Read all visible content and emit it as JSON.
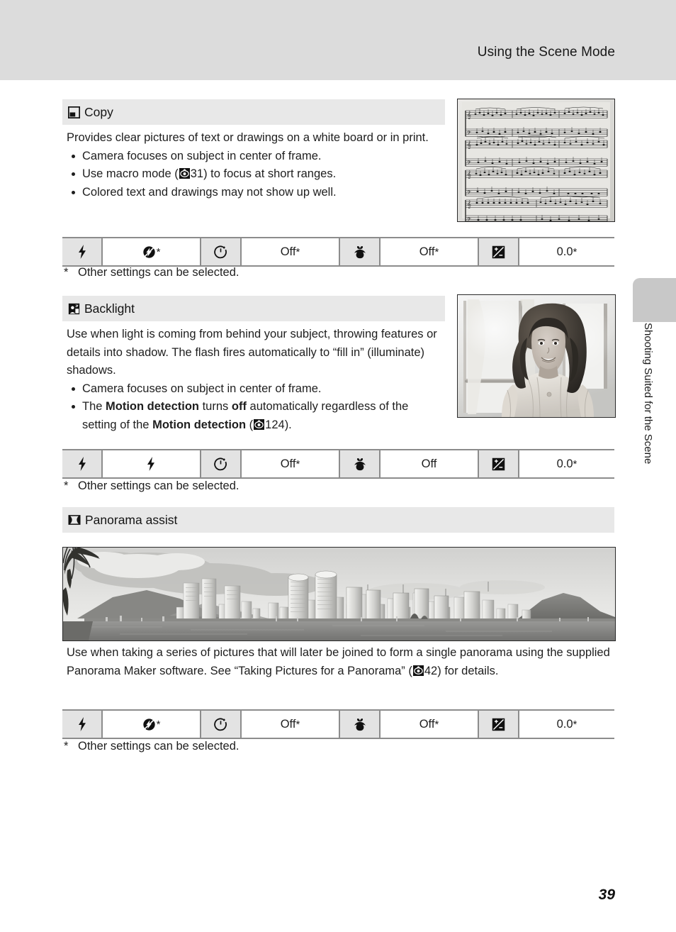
{
  "header": {
    "title": "Using the Scene Mode"
  },
  "side_tab": {
    "label": "Shooting Suited for the Scene"
  },
  "page": {
    "number": "39"
  },
  "sections": [
    {
      "id": "copy",
      "icon_name": "copy-scene-icon",
      "title": "Copy",
      "paragraph": "Provides clear pictures of text or drawings on a white board or in print.",
      "bullets": [
        {
          "pre": "Camera focuses on subject in center of frame.",
          "ref": null,
          "post": ""
        },
        {
          "pre": "Use macro mode (",
          "ref": "31",
          "post": ") to focus at short ranges."
        },
        {
          "pre": "Colored text and drawings may not show up well.",
          "ref": null,
          "post": ""
        }
      ],
      "photo_name": "sheet-music-photo",
      "photo_alt": "Black and white photo of printed sheet music",
      "settings": {
        "flash_icon": "flash-icon",
        "flash_value_icon": "flash-off-icon",
        "flash_value_sup": "*",
        "timer_icon": "self-timer-icon",
        "timer_value": "Off",
        "timer_value_sup": "*",
        "macro_icon": "macro-icon",
        "macro_value": "Off",
        "macro_value_sup": "*",
        "exposure_icon": "exposure-compensation-icon",
        "exposure_value": "0.0",
        "exposure_value_sup": "*"
      },
      "footnote": "Other settings can be selected.",
      "footnote_star": "*"
    },
    {
      "id": "backlight",
      "icon_name": "backlight-scene-icon",
      "title": "Backlight",
      "paragraph": "Use when light is coming from behind your subject, throwing features or details into shadow. The flash fires automatically to “fill in” (illuminate) shadows.",
      "bullets": [
        {
          "text": "Camera focuses on subject in center of frame."
        },
        {
          "text": "The Motion detection turns off automatically regardless of the setting of the Motion detection ( 124)."
        }
      ],
      "bullet2_parts": {
        "a": "The ",
        "b_bold": "Motion detection",
        "c": " turns ",
        "d_bold": "off",
        "e": " automatically regardless of",
        "f": "the setting of the ",
        "g_bold": "Motion detection",
        "h": " (",
        "ref": "124",
        "i": ")."
      },
      "photo_name": "backlit-portrait-photo",
      "photo_alt": "Black and white backlit portrait of a smiling woman by a window",
      "settings": {
        "flash_icon": "flash-icon",
        "flash_value_icon": "flash-fill-icon",
        "flash_value_sup": "",
        "timer_icon": "self-timer-icon",
        "timer_value": "Off",
        "timer_value_sup": "*",
        "macro_icon": "macro-icon",
        "macro_value": "Off",
        "macro_value_sup": "",
        "exposure_icon": "exposure-compensation-icon",
        "exposure_value": "0.0",
        "exposure_value_sup": "*"
      },
      "footnote": "Other settings can be selected.",
      "footnote_star": "*"
    },
    {
      "id": "panorama",
      "icon_name": "panorama-assist-scene-icon",
      "title": "Panorama assist",
      "photo_name": "panorama-cityscape-photo",
      "photo_alt": "Black and white panoramic photo of a city skyline across water with palm leaves",
      "paragraph_parts": {
        "a": "Use when taking a series of pictures that will later be joined to form a single panorama using the supplied Panorama Maker software. See “Taking Pictures for a Panorama” (",
        "ref": "42",
        "b": ") for details."
      },
      "settings": {
        "flash_icon": "flash-icon",
        "flash_value_icon": "flash-off-icon",
        "flash_value_sup": "*",
        "timer_icon": "self-timer-icon",
        "timer_value": "Off",
        "timer_value_sup": "*",
        "macro_icon": "macro-icon",
        "macro_value": "Off",
        "macro_value_sup": "*",
        "exposure_icon": "exposure-compensation-icon",
        "exposure_value": "0.0",
        "exposure_value_sup": "*"
      },
      "footnote": "Other settings can be selected.",
      "footnote_star": "*"
    }
  ]
}
